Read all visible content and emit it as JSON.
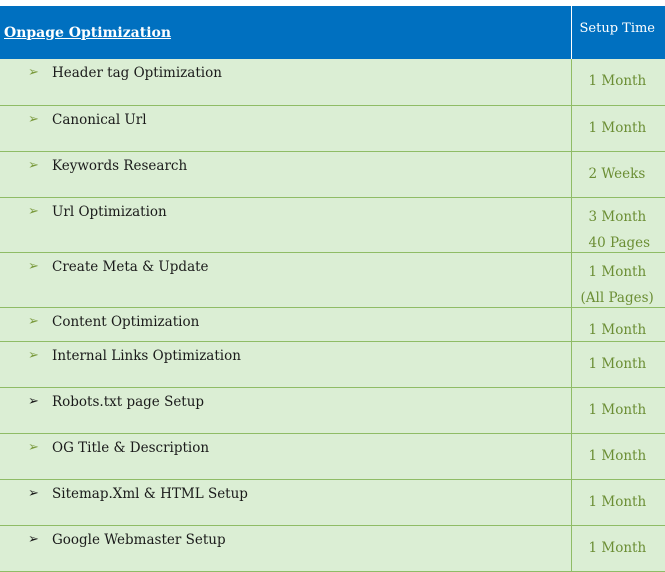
{
  "header": {
    "title": "Onpage Optimization",
    "setup_label": "Setup Time"
  },
  "rows": [
    {
      "task": "Header tag Optimization",
      "time": "1 Month",
      "arrow_dark": false
    },
    {
      "task": "Canonical Url",
      "time": "1 Month",
      "arrow_dark": false
    },
    {
      "task": "Keywords Research",
      "time": "2 Weeks",
      "arrow_dark": false
    },
    {
      "task": "Url Optimization",
      "time": "3 Month",
      "time2": "40 Pages",
      "arrow_dark": false
    },
    {
      "task": "Create Meta & Update",
      "time": "1 Month",
      "time2": "(All Pages)",
      "arrow_dark": false
    },
    {
      "task": "Content Optimization",
      "time": "1 Month",
      "arrow_dark": false
    },
    {
      "task": "Internal Links Optimization",
      "time": "1 Month",
      "arrow_dark": false
    },
    {
      "task": "Robots.txt page Setup",
      "time": "1 Month",
      "arrow_dark": true
    },
    {
      "task": "OG Title & Description",
      "time": "1 Month",
      "arrow_dark": false
    },
    {
      "task": "Sitemap.Xml & HTML Setup",
      "time": "1 Month",
      "arrow_dark": true
    },
    {
      "task": "Google Webmaster Setup",
      "time": "1 Month",
      "arrow_dark": true
    }
  ],
  "icons": {
    "bullet": "arrowhead-bullet-icon"
  },
  "colors": {
    "header_bg": "#0070c0",
    "row_bg": "#dbeed4",
    "border": "#8fbc66",
    "time_text": "#6b8e34"
  }
}
